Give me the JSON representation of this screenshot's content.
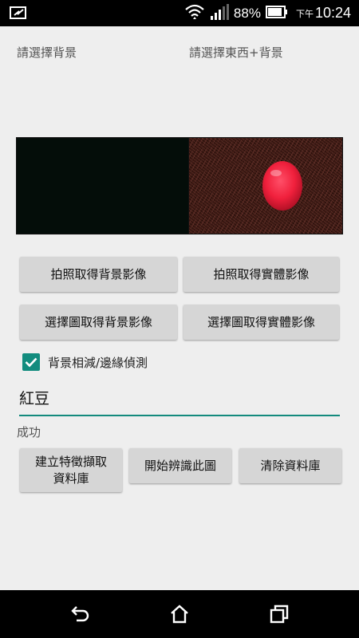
{
  "status_bar": {
    "battery_percent": "88%",
    "ampm": "下午",
    "time": "10:24"
  },
  "labels": {
    "background_prompt": "請選擇背景",
    "object_prompt": "請選擇東西+背景"
  },
  "buttons": {
    "capture_background": "拍照取得背景影像",
    "capture_object": "拍照取得實體影像",
    "pick_background": "選擇圖取得背景影像",
    "pick_object": "選擇圖取得實體影像",
    "build_features_line1": "建立特徵擷取",
    "build_features_line2": "資料庫",
    "start_recognition": "開始辨識此圖",
    "clear_database": "清除資料庫"
  },
  "checkbox": {
    "label": "背景相減/邊緣偵測",
    "checked": true
  },
  "name_field": {
    "value": "紅豆"
  },
  "status_text": "成功",
  "colors": {
    "accent": "#138a7d",
    "button_bg": "#d6d6d6",
    "page_bg": "#eeeeee"
  },
  "icons": {
    "status_left": "mail-sync-icon",
    "wifi": "wifi-icon",
    "signal": "signal-icon",
    "battery": "battery-icon",
    "nav_back": "back-icon",
    "nav_home": "home-icon",
    "nav_recent": "recent-apps-icon"
  }
}
